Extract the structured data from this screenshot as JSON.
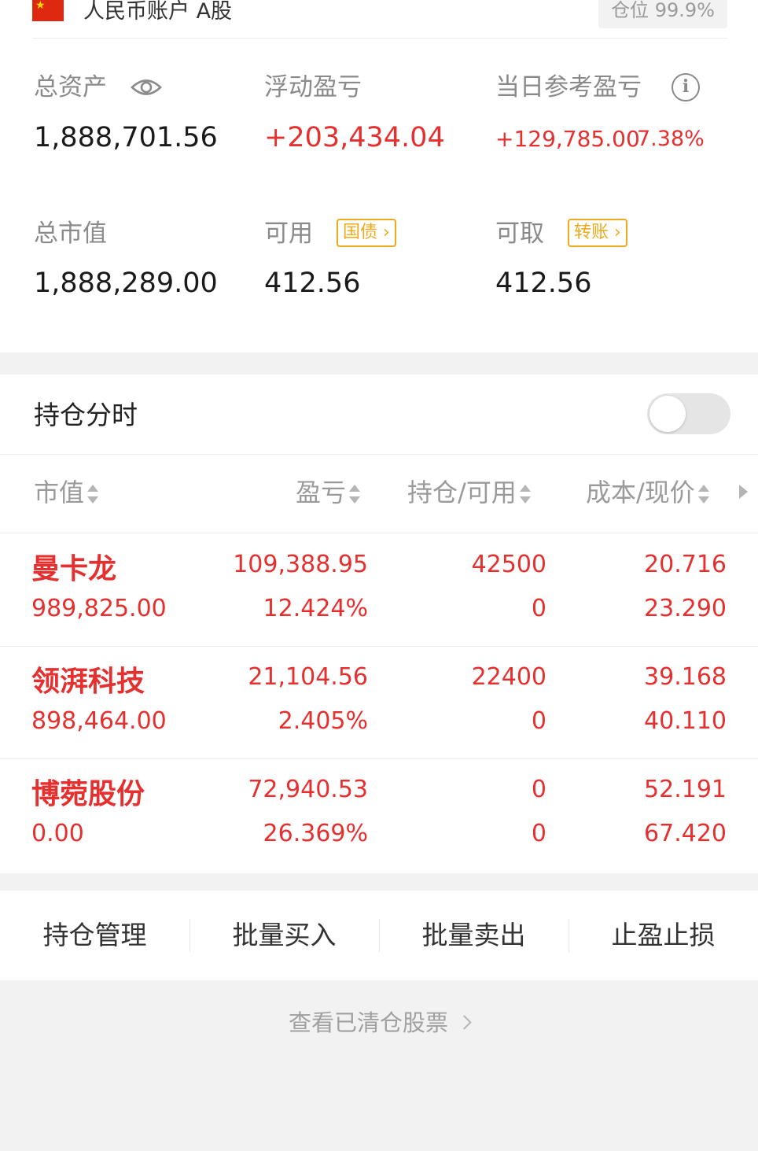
{
  "account": {
    "name": "人民币账户 A股",
    "position_ratio": "仓位 99.9%",
    "flag_icon": "china-flag-icon"
  },
  "summary": {
    "total_assets_label": "总资产",
    "total_assets": "1,888,701.56",
    "floating_pnl_label": "浮动盈亏",
    "floating_pnl": "+203,434.04",
    "daily_pnl_label": "当日参考盈亏",
    "daily_pnl": "+129,785.00",
    "daily_pnl_pct": "7.38%",
    "market_value_label": "总市值",
    "market_value": "1,888,289.00",
    "available_label": "可用",
    "available": "412.56",
    "available_tag": "国债",
    "withdrawable_label": "可取",
    "withdrawable": "412.56",
    "withdrawable_tag": "转账"
  },
  "holdings": {
    "title": "持仓分时",
    "toggle_on": false,
    "columns": [
      "市值",
      "盈亏",
      "持仓/可用",
      "成本/现价"
    ],
    "rows": [
      {
        "name": "曼卡龙",
        "market_value": "989,825.00",
        "pnl": "109,388.95",
        "pnl_pct": "12.424%",
        "position": "42500",
        "available": "0",
        "cost": "20.716",
        "price": "23.290"
      },
      {
        "name": "领湃科技",
        "market_value": "898,464.00",
        "pnl": "21,104.56",
        "pnl_pct": "2.405%",
        "position": "22400",
        "available": "0",
        "cost": "39.168",
        "price": "40.110"
      },
      {
        "name": "博菀股份",
        "market_value": "0.00",
        "pnl": "72,940.53",
        "pnl_pct": "26.369%",
        "position": "0",
        "available": "0",
        "cost": "52.191",
        "price": "67.420"
      }
    ]
  },
  "actions": [
    "持仓管理",
    "批量买入",
    "批量卖出",
    "止盈止损"
  ],
  "cleared_link": "查看已清仓股票",
  "colors": {
    "up_red": "#e5302f",
    "tag_orange": "#f0a91a",
    "label_gray": "#8a8a8a"
  }
}
